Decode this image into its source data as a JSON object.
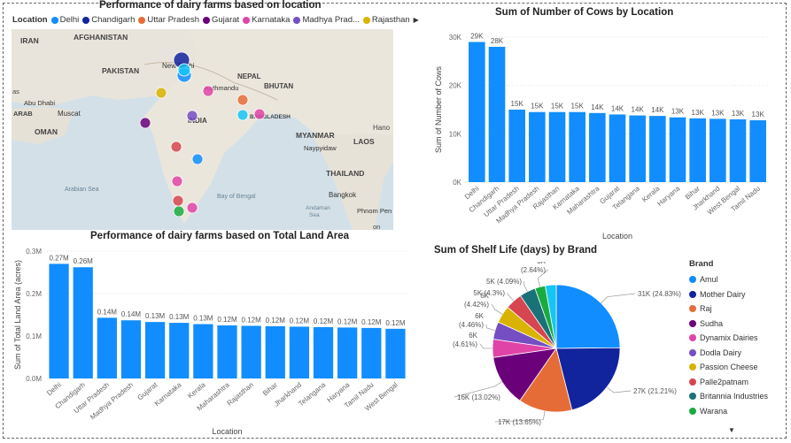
{
  "colors": {
    "bar": "#118DFF"
  },
  "map_visual": {
    "title": "Performance of dairy farms based on location",
    "legend_label": "Location",
    "legend": [
      {
        "name": "Delhi",
        "color": "#118DFF"
      },
      {
        "name": "Chandigarh",
        "color": "#12239E"
      },
      {
        "name": "Uttar Pradesh",
        "color": "#E66C37"
      },
      {
        "name": "Gujarat",
        "color": "#6B007B"
      },
      {
        "name": "Karnataka",
        "color": "#E044A7"
      },
      {
        "name": "Madhya Prad...",
        "color": "#744EC2"
      },
      {
        "name": "Rajasthan",
        "color": "#D9B300"
      }
    ],
    "more_icon": "triangle-right-icon",
    "map_labels": {
      "iran": "IRAN",
      "afghanistan": "AFGHANISTAN",
      "pakistan": "PAKISTAN",
      "nepal": "NEPAL",
      "bhutan": "BHUTAN",
      "india": "INDIA",
      "oman": "OMAN",
      "myanmar": "MYANMAR",
      "laos": "LAOS",
      "thailand": "THAILAND",
      "newdelhi": "New Delhi",
      "kathmandu": "Kathmandu",
      "muscat": "Muscat",
      "abudhabi": "Abu Dhabi",
      "naypyidaw": "Naypyidaw",
      "bangkok": "Bangkok",
      "arabiansea": "Arabian Sea",
      "bayofbengal": "Bay of Bengal",
      "andaman": "Andaman",
      "sea": "Sea",
      "phnompenh": "Phnom Pen",
      "bangladesh": "BANGLADESH",
      "arab": "ARAB",
      "as": "as",
      "hano": "Hano",
      "on": "on"
    }
  },
  "chart_data": [
    {
      "type": "bar",
      "title": "Sum of Number of Cows by Location",
      "xlabel": "Location",
      "ylabel": "Sum of Number of Cows",
      "ylim": [
        0,
        30000
      ],
      "yticks": [
        "0K",
        "10K",
        "20K",
        "30K"
      ],
      "categories": [
        "Delhi",
        "Chandigarh",
        "Uttar Pradesh",
        "Madhya Pradesh",
        "Rajasthan",
        "Karnataka",
        "Maharashtra",
        "Gujarat",
        "Telangana",
        "Kerala",
        "Haryana",
        "Bihar",
        "Jharkhand",
        "West Bengal",
        "Tamil Nadu"
      ],
      "values": [
        29000,
        28000,
        15000,
        14500,
        14500,
        14500,
        14300,
        14000,
        13800,
        13700,
        13400,
        13200,
        13100,
        13000,
        12800
      ],
      "data_labels": [
        "29K",
        "28K",
        "15K",
        "15K",
        "15K",
        "15K",
        "14K",
        "14K",
        "14K",
        "14K",
        "13K",
        "13K",
        "13K",
        "13K",
        "13K"
      ]
    },
    {
      "type": "bar",
      "title": "Performance of dairy farms based on Total Land Area",
      "xlabel": "Location",
      "ylabel": "Sum of Total Land Area (acres)",
      "ylim": [
        0,
        300000
      ],
      "yticks": [
        "0.0M",
        "0.1M",
        "0.2M",
        "0.3M"
      ],
      "categories": [
        "Delhi",
        "Chandigarh",
        "Uttar Pradesh",
        "Madhya Pradesh",
        "Gujarat",
        "Karnataka",
        "Kerala",
        "Maharashtra",
        "Rajasthan",
        "Bihar",
        "Jharkhand",
        "Telangana",
        "Haryana",
        "Tamil Nadu",
        "West Bengal"
      ],
      "values": [
        270000,
        262000,
        143000,
        137000,
        133000,
        131000,
        128000,
        125000,
        124000,
        123000,
        122000,
        121000,
        120000,
        119000,
        117000
      ],
      "data_labels": [
        "0.27M",
        "0.26M",
        "0.14M",
        "0.14M",
        "0.13M",
        "0.13M",
        "0.13M",
        "0.12M",
        "0.12M",
        "0.12M",
        "0.12M",
        "0.12M",
        "0.12M",
        "0.12M",
        "0.12M"
      ]
    },
    {
      "type": "pie",
      "title": "Sum of Shelf Life (days) by Brand",
      "legend_title": "Brand",
      "slices": [
        {
          "name": "Amul",
          "value": 24.83,
          "label": "31K (24.83%)",
          "color": "#118DFF"
        },
        {
          "name": "Mother Dairy",
          "value": 21.21,
          "label": "27K (21.21%)",
          "color": "#12239E"
        },
        {
          "name": "Raj",
          "value": 13.65,
          "label": "17K (13.65%)",
          "color": "#E66C37"
        },
        {
          "name": "Sudha",
          "value": 13.02,
          "label": "16K (13.02%)",
          "color": "#6B007B"
        },
        {
          "name": "Dynamix Dairies",
          "value": 4.61,
          "label": "6K (4.61%)",
          "color": "#E044A7"
        },
        {
          "name": "Dodla Dairy",
          "value": 4.46,
          "label": "6K (4.46%)",
          "color": "#744EC2"
        },
        {
          "name": "Passion Cheese",
          "value": 4.42,
          "label": "6K (4.42%)",
          "color": "#D9B300"
        },
        {
          "name": "Palle2patnam",
          "value": 4.3,
          "label": "5K (4.3%)",
          "color": "#D64550"
        },
        {
          "name": "Britannia Industries",
          "value": 4.09,
          "label": "5K (4.09%)",
          "color": "#197278"
        },
        {
          "name": "Warana",
          "value": 2.64,
          "label": "3K (2.64%)",
          "color": "#1AAB40"
        },
        {
          "name": "",
          "value": 2.77,
          "label": "",
          "color": "#15C6F4"
        }
      ],
      "legend": [
        "Amul",
        "Mother Dairy",
        "Raj",
        "Sudha",
        "Dynamix Dairies",
        "Dodla Dairy",
        "Passion Cheese",
        "Palle2patnam",
        "Britannia Industries",
        "Warana"
      ],
      "legend_scroll_icon": "triangle-down-icon"
    }
  ]
}
